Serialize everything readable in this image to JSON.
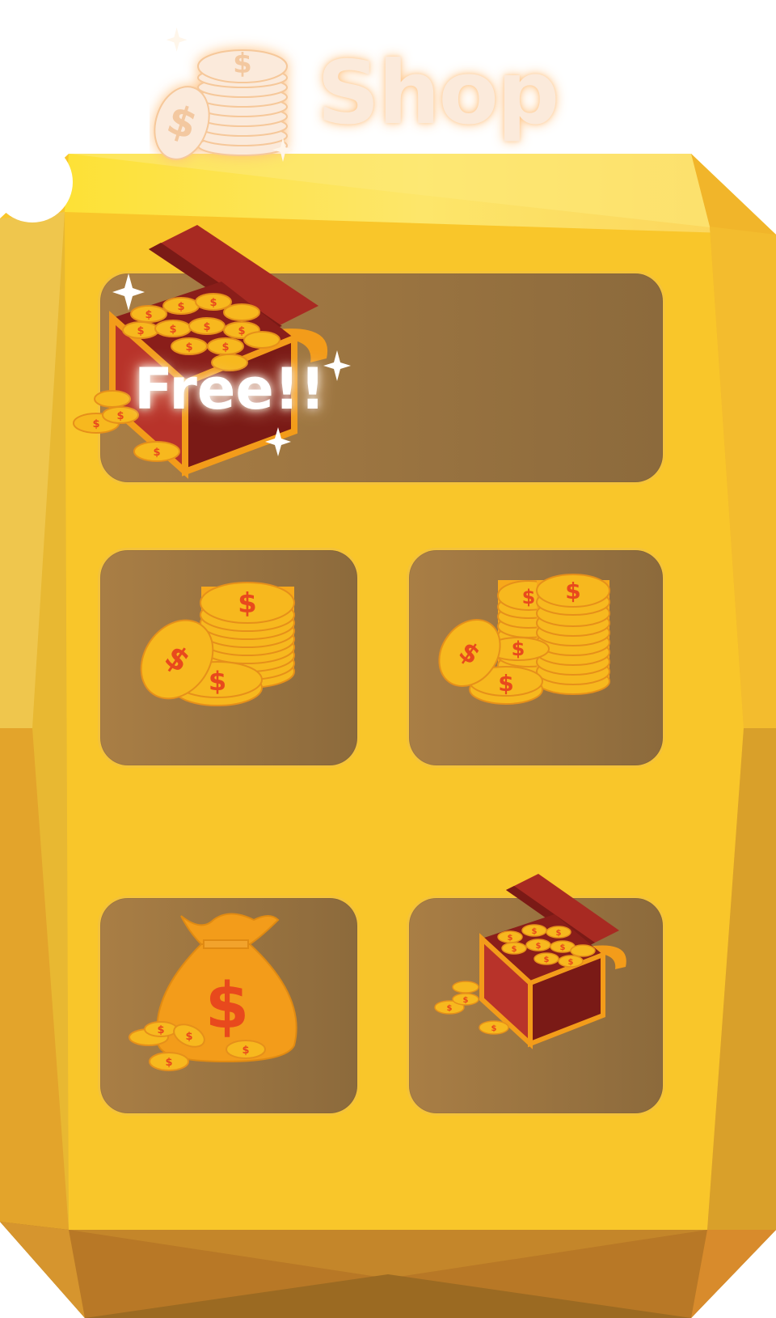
{
  "header": {
    "title": "Shop",
    "icon": "coin-stack-icon"
  },
  "offers": [
    {
      "id": "free",
      "label": "Free!!",
      "icon": "treasure-chest-icon"
    },
    {
      "id": "coin-stack-small",
      "icon": "coin-stack-icon"
    },
    {
      "id": "coin-stack-large",
      "icon": "coin-stacks-icon"
    },
    {
      "id": "money-bag",
      "icon": "money-bag-icon"
    },
    {
      "id": "treasure-chest",
      "icon": "treasure-chest-icon"
    }
  ],
  "colors": {
    "panel": "#f9c62a",
    "slot": "#9a7240",
    "coin": "#f7b81e",
    "dollar": "#e8491d",
    "chest": "#a82a22",
    "title": "#fbeadb"
  }
}
